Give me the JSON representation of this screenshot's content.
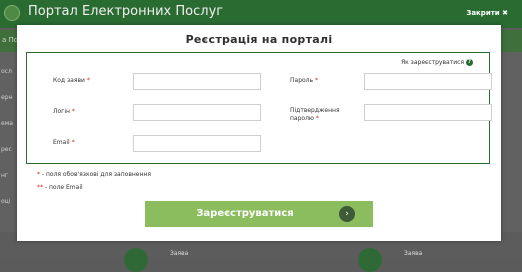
{
  "header": {
    "title": "Портал Електронних Послуг",
    "close_label": "Закрити ✖"
  },
  "background": {
    "strip_text": "а По",
    "left_items": [
      "осл",
      "ерн",
      "ема",
      "рес",
      "нг",
      "оці"
    ],
    "bottom_labels": [
      "Заява",
      "Заява"
    ]
  },
  "modal": {
    "title": "Реєстрація на порталі",
    "help_link": "Як зареєструватися",
    "fields": {
      "request_code": {
        "label": "Код заяви",
        "value": ""
      },
      "password": {
        "label": "Пароль",
        "value": ""
      },
      "login": {
        "label": "Логін",
        "value": ""
      },
      "password_confirm": {
        "label": "Підтвердження паролю",
        "value": ""
      },
      "email": {
        "label": "Email",
        "value": ""
      }
    },
    "required_mark": "*",
    "notes": {
      "required_star": "*",
      "required_text": " - поля обов'язкові для заповнення",
      "email_star": "**",
      "email_text": " - поле Email"
    },
    "submit_label": "Зареєструватися",
    "submit_arrow": "›"
  },
  "colors": {
    "accent": "#2a6b32",
    "button": "#8bbd5f",
    "required": "#d22222"
  }
}
